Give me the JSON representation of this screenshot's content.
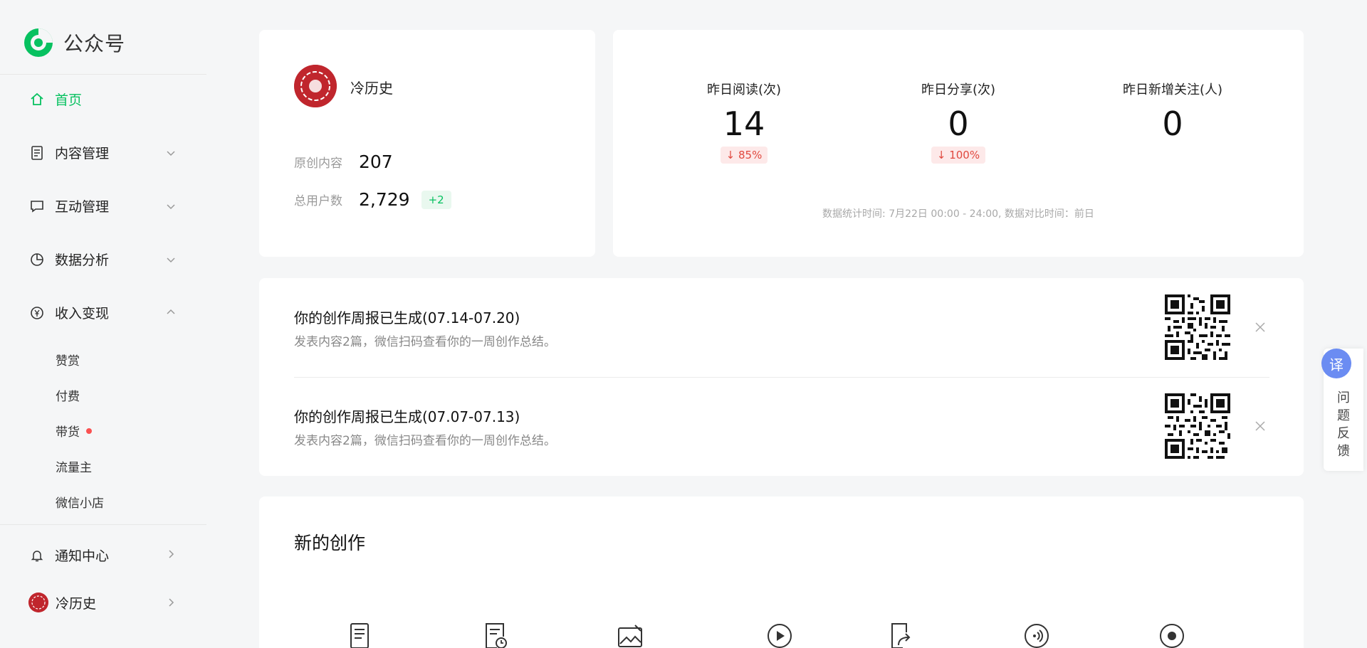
{
  "brand": {
    "name": "公众号"
  },
  "sidebar": {
    "home": "首页",
    "content_mgmt": "内容管理",
    "interaction_mgmt": "互动管理",
    "data_analysis": "数据分析",
    "monetization": "收入变现",
    "monetization_items": [
      "赞赏",
      "付费",
      "带货",
      "流量主",
      "微信小店"
    ],
    "notifications": "通知中心",
    "account": "冷历史"
  },
  "profile": {
    "name": "冷历史",
    "original_label": "原创内容",
    "original_value": "207",
    "users_label": "总用户数",
    "users_value": "2,729",
    "users_delta": "+2"
  },
  "stats": {
    "reads_label": "昨日阅读(次)",
    "reads_value": "14",
    "reads_delta": "↓ 85%",
    "shares_label": "昨日分享(次)",
    "shares_value": "0",
    "shares_delta": "↓ 100%",
    "follows_label": "昨日新增关注(人)",
    "follows_value": "0",
    "note": "数据统计时间: 7月22日 00:00 - 24:00, 数据对比时间：前日"
  },
  "reports": [
    {
      "title": "你的创作周报已生成(07.14-07.20)",
      "subtitle": "发表内容2篇，微信扫码查看你的一周创作总结。"
    },
    {
      "title": "你的创作周报已生成(07.07-07.13)",
      "subtitle": "发表内容2篇，微信扫码查看你的一周创作总结。"
    }
  ],
  "create": {
    "title": "新的创作"
  },
  "floating": {
    "translate": "译",
    "feedback": "问题反馈"
  },
  "colors": {
    "accent": "#07c160",
    "alert": "#fa5151"
  }
}
